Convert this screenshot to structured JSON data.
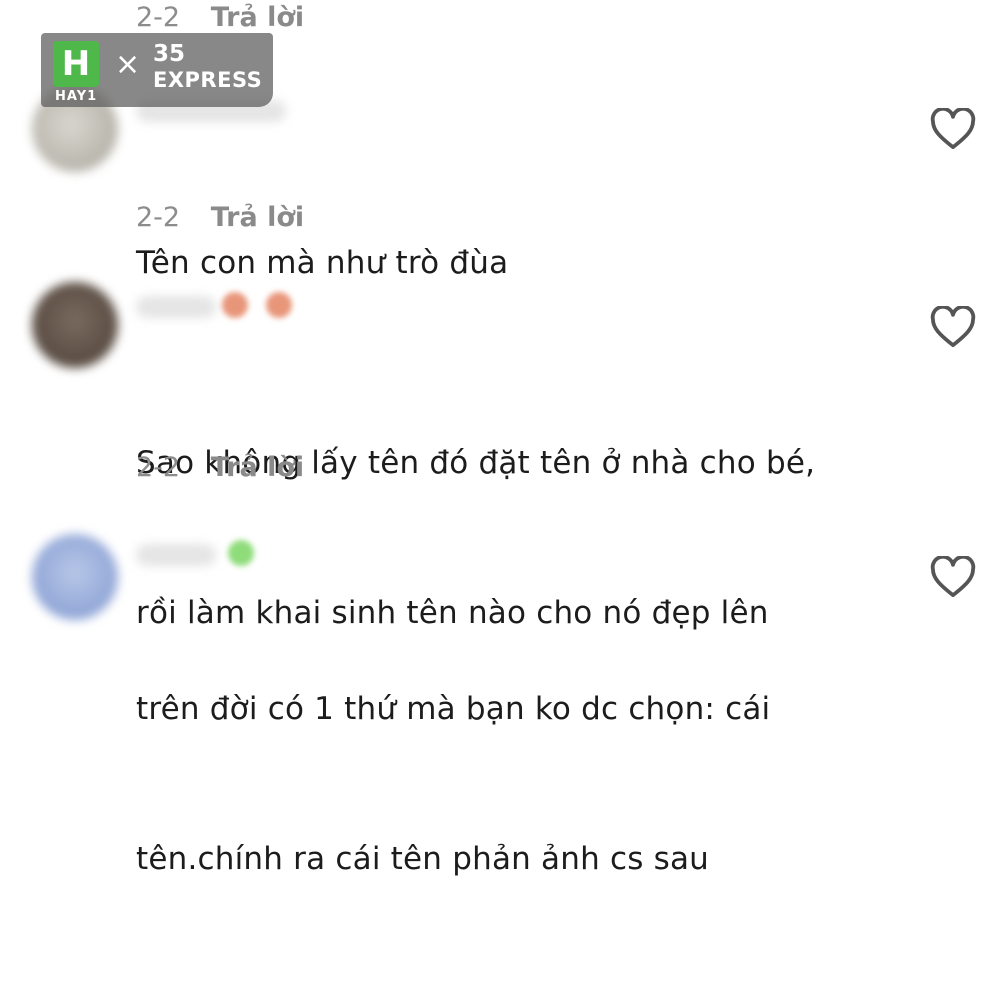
{
  "top_meta": {
    "date": "2-2",
    "reply": "Trả lời"
  },
  "watermark": {
    "h_letter": "H",
    "hay": "HAY1",
    "x": "×",
    "num": "35",
    "express": "EXPRESS",
    "h_color": "#4fb84a"
  },
  "comments": [
    {
      "lines": [
        "Tên con mà như trò đùa"
      ],
      "date": "2-2",
      "reply": "Trả lời",
      "icon": "heart-outline-icon"
    },
    {
      "lines": [
        "Sao không lấy tên đó đặt tên ở nhà cho bé,",
        "rồi làm khai sinh tên nào cho nó đẹp lên"
      ],
      "date": "2-2",
      "reply": "Trả lời",
      "icon": "heart-outline-icon"
    },
    {
      "lines": [
        "trên đời có 1 thứ mà bạn ko dc chọn: cái",
        "tên.chính ra cái tên phản ảnh cs sau"
      ],
      "icon": "heart-outline-icon"
    }
  ],
  "colors": {
    "text": "#1c1c1c",
    "meta": "#8c8c8c",
    "heart": "#555555"
  }
}
